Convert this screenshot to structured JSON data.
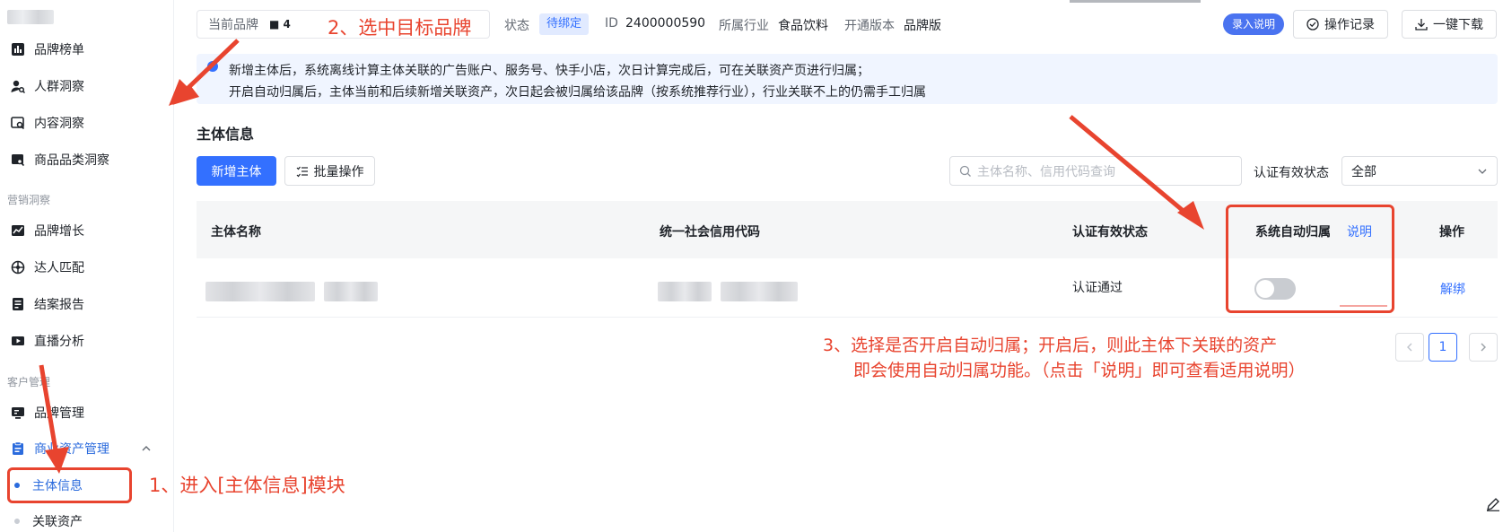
{
  "sidebar": {
    "items_top": [
      {
        "label": "品牌榜单",
        "icon": "bar-chart-icon"
      },
      {
        "label": "人群洞察",
        "icon": "user-search-icon"
      },
      {
        "label": "内容洞察",
        "icon": "content-search-icon"
      },
      {
        "label": "商品品类洞察",
        "icon": "product-search-icon"
      }
    ],
    "group_marketing": "营销洞察",
    "items_marketing": [
      {
        "label": "品牌增长",
        "icon": "trend-icon"
      },
      {
        "label": "达人匹配",
        "icon": "target-icon"
      },
      {
        "label": "结案报告",
        "icon": "report-icon"
      },
      {
        "label": "直播分析",
        "icon": "video-icon"
      }
    ],
    "group_customer": "客户管理",
    "items_customer": [
      {
        "label": "品牌管理",
        "icon": "monitor-icon"
      },
      {
        "label": "商业资产管理",
        "icon": "clipboard-icon"
      }
    ],
    "sub_items": [
      {
        "label": "主体信息",
        "active": true
      },
      {
        "label": "关联资产",
        "active": false
      }
    ]
  },
  "header": {
    "brand_label": "当前品牌",
    "brand_value": "■ 4",
    "status_label": "状态",
    "status_value": "待绑定",
    "id_label": "ID",
    "id_value": "2400000590",
    "industry_label": "所属行业",
    "industry_value": "食品饮料",
    "version_label": "开通版本",
    "version_value": "品牌版",
    "intro_button": "录入说明",
    "log_button": "操作记录",
    "download_button": "一键下载"
  },
  "notice": {
    "line1": "新增主体后，系统离线计算主体关联的广告账户、服务号、快手小店，次日计算完成后，可在关联资产页进行归属；",
    "line2": "开启自动归属后，主体当前和后续新增关联资产，次日起会被归属给该品牌（按系统推荐行业），行业关联不上的仍需手工归属"
  },
  "section": {
    "title": "主体信息",
    "add_button": "新增主体",
    "batch_button": "批量操作",
    "search_placeholder": "主体名称、信用代码查询",
    "filter_label": "认证有效状态",
    "filter_value": "全部"
  },
  "table": {
    "headers": [
      "主体名称",
      "统一社会信用代码",
      "认证有效状态",
      "系统自动归属",
      "操作"
    ],
    "header_help_link": "说明",
    "rows": [
      {
        "status": "认证通过",
        "auto_assign": false,
        "action": "解绑"
      }
    ]
  },
  "pagination": {
    "current": "1"
  },
  "annotations": {
    "step1": "1、进入[主体信息]模块",
    "step2": "2、选中目标品牌",
    "step3_line1": "3、选择是否开启自动归属；开启后，则此主体下关联的资产",
    "step3_line2": "即会使用自动归属功能。（点击「说明」即可查看适用说明）",
    "color": "#e8442f"
  },
  "colors": {
    "primary": "#3370ff",
    "annotation": "#e8442f",
    "notice_bg": "#f0f5ff"
  }
}
